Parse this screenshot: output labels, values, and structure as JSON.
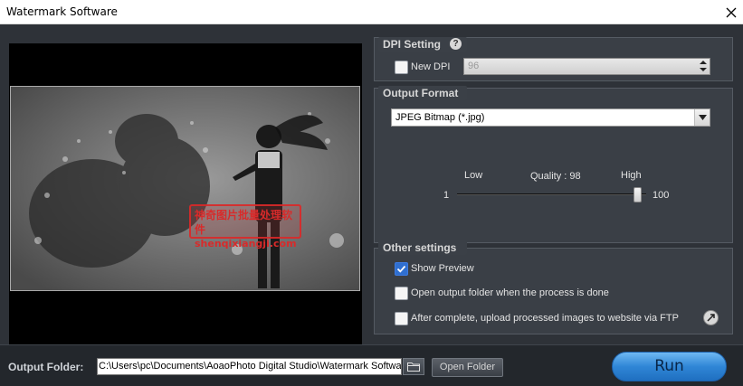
{
  "window": {
    "title": "Watermark Software"
  },
  "preview": {
    "watermark_line1": "神奇图片批量处理软件",
    "watermark_line2": "shenqixiangji.com"
  },
  "dpi": {
    "group_title": "DPI Setting",
    "new_dpi_label": "New DPI",
    "new_dpi_checked": false,
    "value": "96"
  },
  "output_format": {
    "group_title": "Output Format",
    "selected": "JPEG Bitmap (*.jpg)",
    "quality_low_label": "Low",
    "quality_label": "Quality : 98",
    "quality_high_label": "High",
    "quality_min": "1",
    "quality_max": "100",
    "quality_value": 98
  },
  "other_settings": {
    "group_title": "Other settings",
    "show_preview_label": "Show Preview",
    "show_preview_checked": true,
    "open_output_label": "Open output folder when the process is done",
    "open_output_checked": false,
    "ftp_label": "After complete, upload processed images to website via FTP",
    "ftp_checked": false
  },
  "bottom": {
    "output_folder_label": "Output Folder:",
    "path_value": "C:\\Users\\pc\\Documents\\AoaoPhoto Digital Studio\\Watermark Softwa",
    "open_folder_label": "Open Folder",
    "run_label": "Run"
  },
  "colors": {
    "background": "#2e3238",
    "panel": "#3a3f46",
    "run_button": "#2f86d6",
    "checkbox_checked": "#2f6fd0"
  }
}
